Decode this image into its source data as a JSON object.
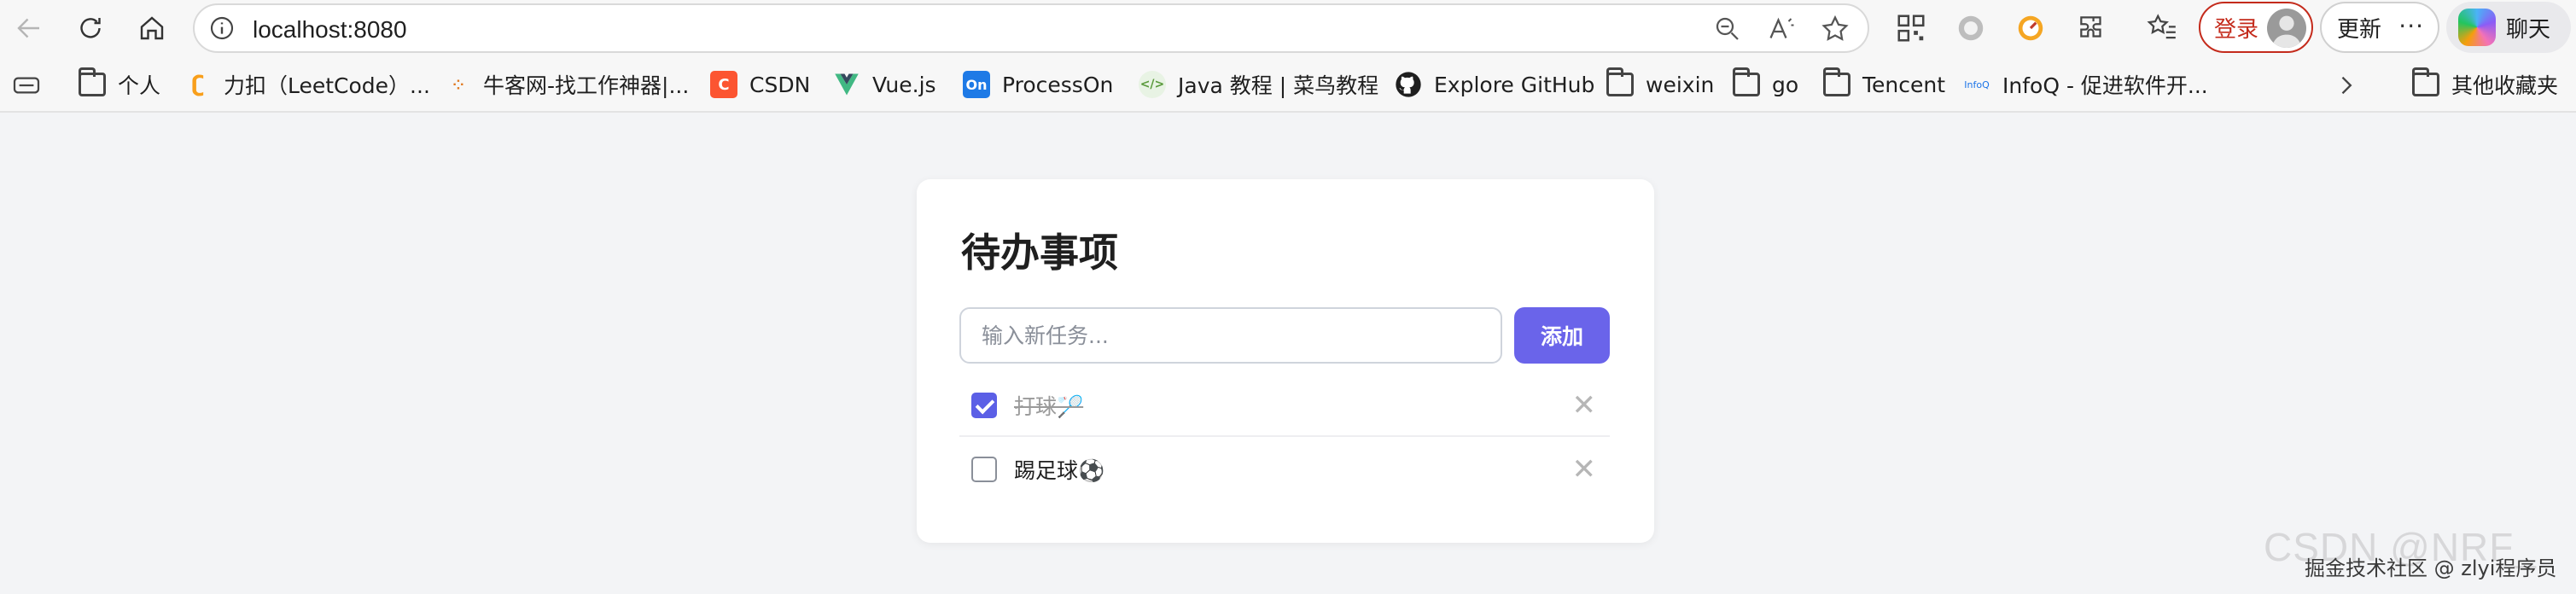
{
  "browser": {
    "url": "localhost:8080",
    "login_label": "登录",
    "update_label": "更新",
    "more_label": "···",
    "chat_label": "聊天"
  },
  "bookmarks": [
    {
      "label": "个人",
      "icon": "folder-icon"
    },
    {
      "label": "力扣（LeetCode）...",
      "icon": "leetcode-icon"
    },
    {
      "label": "牛客网-找工作神器|...",
      "icon": "nowcoder-icon"
    },
    {
      "label": "CSDN",
      "icon": "csdn-icon"
    },
    {
      "label": "Vue.js",
      "icon": "vue-icon"
    },
    {
      "label": "ProcessOn",
      "icon": "processon-icon"
    },
    {
      "label": "Java 教程 | 菜鸟教程",
      "icon": "runoob-icon"
    },
    {
      "label": "Explore GitHub",
      "icon": "github-icon"
    },
    {
      "label": "weixin",
      "icon": "folder-icon"
    },
    {
      "label": "go",
      "icon": "folder-icon"
    },
    {
      "label": "Tencent",
      "icon": "folder-icon"
    },
    {
      "label": "InfoQ - 促进软件开...",
      "icon": "infoq-icon"
    },
    {
      "label": "其他收藏夹",
      "icon": "folder-icon"
    }
  ],
  "todo_app": {
    "title": "待办事项",
    "input_placeholder": "输入新任务...",
    "add_label": "添加",
    "items": [
      {
        "text": "打球🏸",
        "done": true,
        "delete": "✕"
      },
      {
        "text": "踢足球⚽",
        "done": false,
        "delete": "✕"
      }
    ]
  },
  "watermark": {
    "line1": "CSDN @NRF_",
    "line2": "掘金技术社区 @ zlyi程序员"
  },
  "colors": {
    "accent": "#6a64ea",
    "page_bg": "#f3f4f6",
    "login_red": "#c42b1c"
  }
}
